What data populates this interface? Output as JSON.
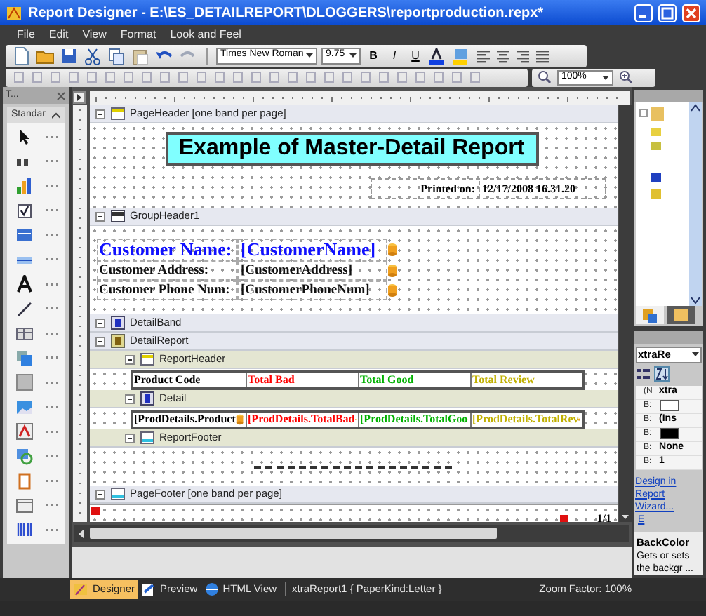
{
  "window": {
    "title": "Report Designer  - E:\\ES_DETAILREPORT\\DLOGGERS\\reportproduction.repx*"
  },
  "menu": [
    "File",
    "Edit",
    "View",
    "Format",
    "Look and Feel"
  ],
  "toolbar": {
    "font_name": "Times New Roman",
    "font_size": "9.75",
    "bold": "B",
    "italic": "I",
    "underline": "U",
    "zoom": "100%"
  },
  "toolbox": {
    "title": "T...",
    "group": "Standar",
    "items": [
      {
        "kind": "pointer"
      },
      {
        "kind": "label"
      },
      {
        "kind": "chart"
      },
      {
        "kind": "check"
      },
      {
        "kind": "panel"
      },
      {
        "kind": "rule"
      },
      {
        "kind": "text"
      },
      {
        "kind": "line"
      },
      {
        "kind": "table"
      },
      {
        "kind": "subreport"
      },
      {
        "kind": "grid"
      },
      {
        "kind": "image"
      },
      {
        "kind": "richtext"
      },
      {
        "kind": "refresh"
      },
      {
        "kind": "pagebreak"
      },
      {
        "kind": "calendar"
      },
      {
        "kind": "barcode"
      }
    ]
  },
  "designer": {
    "page_header": {
      "label": "PageHeader [one band per page]",
      "expanded": true,
      "title": "Example of Master-Detail Report",
      "printed_label": "Printed on:",
      "printed_value": "12/17/2008 16.31.20"
    },
    "group_header": {
      "label": "GroupHeader1",
      "expanded": true,
      "fields": [
        {
          "label": "Customer Name:",
          "value": "[CustomerName]",
          "kind": "large"
        },
        {
          "label": "Customer Address:",
          "value": "[CustomerAddress]",
          "kind": "normal"
        },
        {
          "label": "Customer Phone Num:",
          "value": "[CustomerPhoneNum]",
          "kind": "normal"
        }
      ]
    },
    "detail_band": {
      "label": "DetailBand",
      "expanded": true
    },
    "detail_report": {
      "label": "DetailReport",
      "expanded": true,
      "children": [
        {
          "label": "ReportHeader",
          "expanded": true,
          "kind": "header",
          "cells": [
            {
              "text": "Product Code",
              "color": "#000000"
            },
            {
              "text": "Total Bad",
              "color": "#ff0000"
            },
            {
              "text": "Total Good",
              "color": "#00b000"
            },
            {
              "text": "Total Review",
              "color": "#c0b000"
            }
          ]
        },
        {
          "label": "Detail",
          "expanded": true,
          "kind": "detail",
          "cells": [
            {
              "text": "[ProdDetails.Product",
              "color": "#000000"
            },
            {
              "text": "[ProdDetails.TotalBad",
              "color": "#ff0000"
            },
            {
              "text": "[ProdDetails.TotalGoo",
              "color": "#00b000"
            },
            {
              "text": "[ProdDetails.TotalRev",
              "color": "#c0b000"
            }
          ]
        },
        {
          "label": "ReportFooter",
          "expanded": true,
          "kind": "footer"
        }
      ]
    },
    "page_footer": {
      "label": "PageFooter [one band per page]",
      "expanded": true,
      "page_number": "1/1"
    }
  },
  "properties": {
    "object": "xtraRe",
    "rows": [
      {
        "name": "(N",
        "value": "xtra",
        "kind": "text"
      },
      {
        "name": "B:",
        "color": "#ffffff",
        "kind": "swatch"
      },
      {
        "name": "B:",
        "value": "(Ins",
        "kind": "text"
      },
      {
        "name": "B:",
        "color": "#000000",
        "kind": "swatch"
      },
      {
        "name": "B:",
        "value": "None",
        "kind": "text"
      },
      {
        "name": "B:",
        "value": "1",
        "kind": "text"
      }
    ],
    "link": "Design in Report Wizard...",
    "link_2": "E",
    "description_title": "BackColor",
    "description": "Gets or sets the backgr ..."
  },
  "bottom_tabs": [
    {
      "label": "Designer",
      "selected": true
    },
    {
      "label": "Preview",
      "selected": false
    },
    {
      "label": "HTML View",
      "selected": false
    }
  ],
  "status": {
    "report": "xtraReport1 { PaperKind:Letter }",
    "zoom": "Zoom Factor: 100%"
  }
}
